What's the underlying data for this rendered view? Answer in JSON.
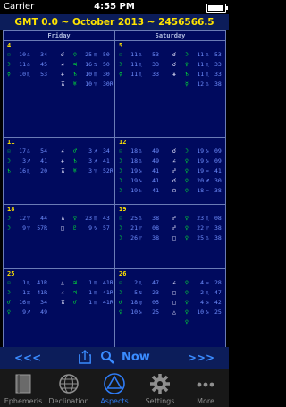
{
  "status": {
    "carrier": "Carrier",
    "time": "4:55 PM"
  },
  "header": {
    "title": "GMT 0.0 ~ October 2013 ~ 2456566.5"
  },
  "calendar": {
    "day_headers": [
      "Friday",
      "Saturday"
    ],
    "cells": [
      {
        "day": "4",
        "rows": [
          [
            "☉",
            "10",
            "♎",
            "34",
            "☌",
            "♀",
            "25",
            "♏",
            "50"
          ],
          [
            "☽",
            "11",
            "♎",
            "45",
            "∠",
            "♃",
            "16",
            "♋",
            "50"
          ],
          [
            "☿",
            "10",
            "♏",
            "53",
            "⚹",
            "♄",
            "10",
            "♏",
            "30"
          ],
          [
            "",
            "",
            "",
            "",
            "⊼",
            "♅",
            "10",
            "♈",
            "30R"
          ]
        ]
      },
      {
        "day": "5",
        "rows": [
          [
            "☉",
            "11",
            "♎",
            "53",
            "☌",
            "☽",
            "11",
            "♎",
            "53"
          ],
          [
            "☽",
            "11",
            "♏",
            "33",
            "☌",
            "♀",
            "11",
            "♏",
            "33"
          ],
          [
            "☿",
            "11",
            "♏",
            "33",
            "⚹",
            "♄",
            "11",
            "♏",
            "33"
          ],
          [
            "",
            "",
            "",
            "",
            "",
            "☿",
            "12",
            "♎",
            "38"
          ]
        ]
      },
      {
        "day": "11",
        "rows": [
          [
            "☉",
            "17",
            "♎",
            "54",
            "∠",
            "♂",
            "3",
            "♐",
            "34"
          ],
          [
            "☽",
            "3",
            "♐",
            "41",
            "⚹",
            "♄",
            "3",
            "♐",
            "41"
          ],
          [
            "♄",
            "16",
            "♏",
            "20",
            "⊼",
            "♅",
            "3",
            "♈",
            "52R"
          ],
          [
            "",
            "",
            "",
            "",
            "",
            "",
            "",
            "",
            ""
          ]
        ]
      },
      {
        "day": "12",
        "rows": [
          [
            "☉",
            "18",
            "♎",
            "49",
            "☌",
            "☽",
            "19",
            "♑",
            "09"
          ],
          [
            "☽",
            "18",
            "♎",
            "49",
            "∠",
            "♀",
            "19",
            "♑",
            "09"
          ],
          [
            "☽",
            "19",
            "♑",
            "41",
            "☍",
            "♀",
            "19",
            "♒",
            "41"
          ],
          [
            "☽",
            "19",
            "♑",
            "41",
            "☌",
            "♀",
            "20",
            "♐",
            "30"
          ],
          [
            "☽",
            "19",
            "♑",
            "41",
            "☊",
            "♀",
            "18",
            "♒",
            "38"
          ]
        ]
      },
      {
        "day": "18",
        "rows": [
          [
            "☽",
            "12",
            "♈",
            "44",
            "⊼",
            "♀",
            "23",
            "♏",
            "43"
          ],
          [
            "☽",
            "9",
            "♈",
            "57R",
            "□",
            "♇",
            "9",
            "♑",
            "57"
          ],
          [
            "",
            "",
            "",
            "",
            "",
            "",
            "",
            "",
            ""
          ]
        ]
      },
      {
        "day": "19",
        "rows": [
          [
            "☉",
            "25",
            "♎",
            "38",
            "☍",
            "♀",
            "23",
            "♏",
            "08"
          ],
          [
            "☽",
            "21",
            "♈",
            "08",
            "☍",
            "♀",
            "22",
            "♈",
            "38"
          ],
          [
            "☽",
            "26",
            "♈",
            "38",
            "□",
            "♀",
            "25",
            "♎",
            "38"
          ]
        ]
      },
      {
        "day": "25",
        "rows": [
          [
            "☉",
            "1",
            "♏",
            "41R",
            "△",
            "♃",
            "1",
            "♏",
            "41R"
          ],
          [
            "☽",
            "1",
            "♊",
            "41R",
            "∠",
            "♃",
            "1",
            "♏",
            "41R"
          ],
          [
            "♂",
            "16",
            "♍",
            "34",
            "⊼",
            "♂",
            "1",
            "♏",
            "41R"
          ],
          [
            "♀",
            "9",
            "♐",
            "49",
            "",
            "",
            "",
            "",
            ""
          ]
        ]
      },
      {
        "day": "26",
        "rows": [
          [
            "☉",
            "2",
            "♏",
            "47",
            "∠",
            "♀",
            "4",
            "♒",
            "28"
          ],
          [
            "☽",
            "5",
            "♋",
            "23",
            "□",
            "♀",
            "2",
            "♏",
            "47"
          ],
          [
            "♂",
            "18",
            "♍",
            "05",
            "□",
            "♀",
            "4",
            "♑",
            "42"
          ],
          [
            "♀",
            "10",
            "♑",
            "25",
            "△",
            "♀",
            "10",
            "♑",
            "25"
          ],
          [
            "",
            "",
            "",
            "",
            "",
            "♀",
            "",
            "",
            ""
          ]
        ]
      }
    ]
  },
  "nav": {
    "prev": "<<<",
    "now": "Now",
    "next": ">>>"
  },
  "tabs": [
    {
      "label": "Ephemeris",
      "icon": "book-icon"
    },
    {
      "label": "Declination",
      "icon": "globe-icon"
    },
    {
      "label": "Aspects",
      "icon": "triangle-icon"
    },
    {
      "label": "Settings",
      "icon": "gear-icon"
    },
    {
      "label": "More",
      "icon": "more-icon"
    }
  ],
  "colors": {
    "accent": "#2f7cf6",
    "header_text": "#ffe400",
    "planet": "#00ee33",
    "grid_bg": "#000a5e"
  }
}
